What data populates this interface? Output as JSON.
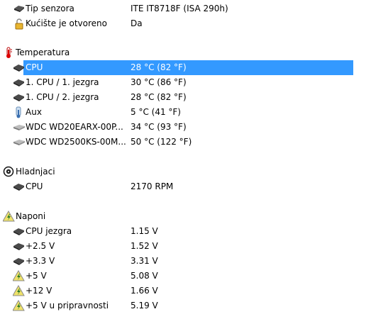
{
  "info": {
    "sensor_type": {
      "label": "Tip senzora",
      "value": "ITE IT8718F  (ISA 290h)",
      "icon": "chip-icon"
    },
    "case_open": {
      "label": "Kućište je otvoreno",
      "value": "Da",
      "icon": "lock-icon"
    }
  },
  "temperature": {
    "title": "Temperatura",
    "items": [
      {
        "label": "CPU",
        "value": "28 °C  (82 °F)",
        "icon": "cpu-icon",
        "selected": true
      },
      {
        "label": "1. CPU / 1. jezgra",
        "value": "30 °C  (86 °F)",
        "icon": "cpu-icon"
      },
      {
        "label": "1. CPU / 2. jezgra",
        "value": "28 °C  (82 °F)",
        "icon": "cpu-icon"
      },
      {
        "label": "Aux",
        "value": "5 °C  (41 °F)",
        "icon": "thermometer-icon"
      },
      {
        "label": "WDC WD20EARX-00P...",
        "value": "34 °C  (93 °F)",
        "icon": "disk-icon"
      },
      {
        "label": "WDC WD2500KS-00M...",
        "value": "50 °C  (122 °F)",
        "icon": "disk-icon"
      }
    ]
  },
  "coolers": {
    "title": "Hladnjaci",
    "items": [
      {
        "label": "CPU",
        "value": "2170 RPM",
        "icon": "cpu-icon"
      }
    ]
  },
  "voltages": {
    "title": "Naponi",
    "items": [
      {
        "label": "CPU jezgra",
        "value": "1.15 V",
        "icon": "cpu-icon"
      },
      {
        "label": "+2.5 V",
        "value": "1.52 V",
        "icon": "cpu-icon"
      },
      {
        "label": "+3.3 V",
        "value": "3.31 V",
        "icon": "cpu-icon"
      },
      {
        "label": "+5 V",
        "value": "5.08 V",
        "icon": "warning-voltage-icon"
      },
      {
        "label": "+12 V",
        "value": "1.66 V",
        "icon": "warning-voltage-icon"
      },
      {
        "label": "+5 V u pripravnosti",
        "value": "5.19 V",
        "icon": "warning-voltage-icon"
      }
    ]
  }
}
